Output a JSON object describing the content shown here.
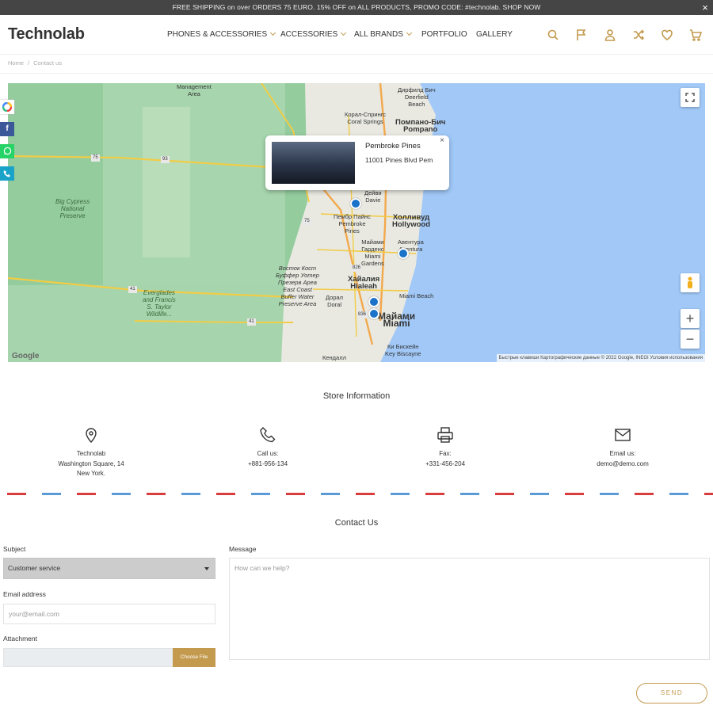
{
  "topbar": {
    "message": "FREE SHIPPING on over ORDERS 75 EURO. 15% OFF on ALL PRODUCTS, PROMO CODE: #technolab. SHOP NOW",
    "close": "×"
  },
  "header": {
    "logo": "Technolab",
    "nav": [
      "PHONES & ACCESSORIES",
      "ACCESSORIES",
      "ALL BRANDS",
      "PORTFOLIO",
      "GALLERY"
    ],
    "icons": [
      "search-icon",
      "flag-icon",
      "user-icon",
      "shuffle-icon",
      "heart-icon",
      "cart-icon"
    ]
  },
  "breadcrumb": {
    "home": "Home",
    "sep": "/",
    "current": "Contact us"
  },
  "map": {
    "popup": {
      "title": "Pembroke Pines",
      "address": "11001 Pines Blvd Pem",
      "close": "×"
    },
    "labels": {
      "management": "Management\nArea",
      "deerfield": "Дирфилд Бич\nDeerfield\nBeach",
      "coral_springs": "Корал-Спрингс\nCoral Springs",
      "pompano": "Помпано-Бич\nPompano",
      "big_cypress": "Big Cypress\nNational\nPreserve",
      "davie": "Дейви\nDavie",
      "hollywood": "Холливуд\nHollywood",
      "pembroke": "Пембр  Пайнс\nPembroke\nPines",
      "aventura": "Авентура\nAventura",
      "miami_gardens": "Майами\nГарденс\nMiami\nGardens",
      "east_coast": "Восток Кост\nБуффер Уотер\nПрезерв Ареа\nEast Coast\nBuffer Water\nPreserve Area",
      "hialeah": "Хайалия\nHialeah",
      "doral": "Дорал\nDoral",
      "miami_beach": "Miami Beach",
      "everglades": "Everglades\nand Francis\nS. Taylor\nWildlife...",
      "miami": "Майами\nMiami",
      "key_biscayne": "Ки Бискейн\nKey Biscayne",
      "kendall": "Кендалл",
      "shields": [
        "75",
        "93",
        "75",
        "41",
        "41",
        "826",
        "836"
      ]
    },
    "footer": "Быстрые клавиши   Картографические данные © 2022 Google, INEGI   Условия использования",
    "google": "Google",
    "zoom_in": "+",
    "zoom_out": "−"
  },
  "social": [
    "color-wheel-icon",
    "facebook-icon",
    "whatsapp-icon",
    "phone-share-icon"
  ],
  "store": {
    "title": "Store Information",
    "items": [
      {
        "icon": "map-pin-icon",
        "lines": [
          "Technolab",
          "Washington Square, 14",
          "New York."
        ]
      },
      {
        "icon": "phone-icon",
        "lines": [
          "Call us:",
          "+881-956-134"
        ]
      },
      {
        "icon": "fax-icon",
        "lines": [
          "Fax:",
          "+331-456-204"
        ]
      },
      {
        "icon": "mail-icon",
        "lines": [
          "Email us:",
          "demo@demo.com"
        ]
      }
    ]
  },
  "contact": {
    "title": "Contact Us",
    "subject_label": "Subject",
    "subject_value": "Customer service",
    "email_label": "Email address",
    "email_placeholder": "your@email.com",
    "attachment_label": "Attachment",
    "choose_file": "Choose File",
    "message_label": "Message",
    "message_placeholder": "How can we help?",
    "send": "SEND"
  }
}
